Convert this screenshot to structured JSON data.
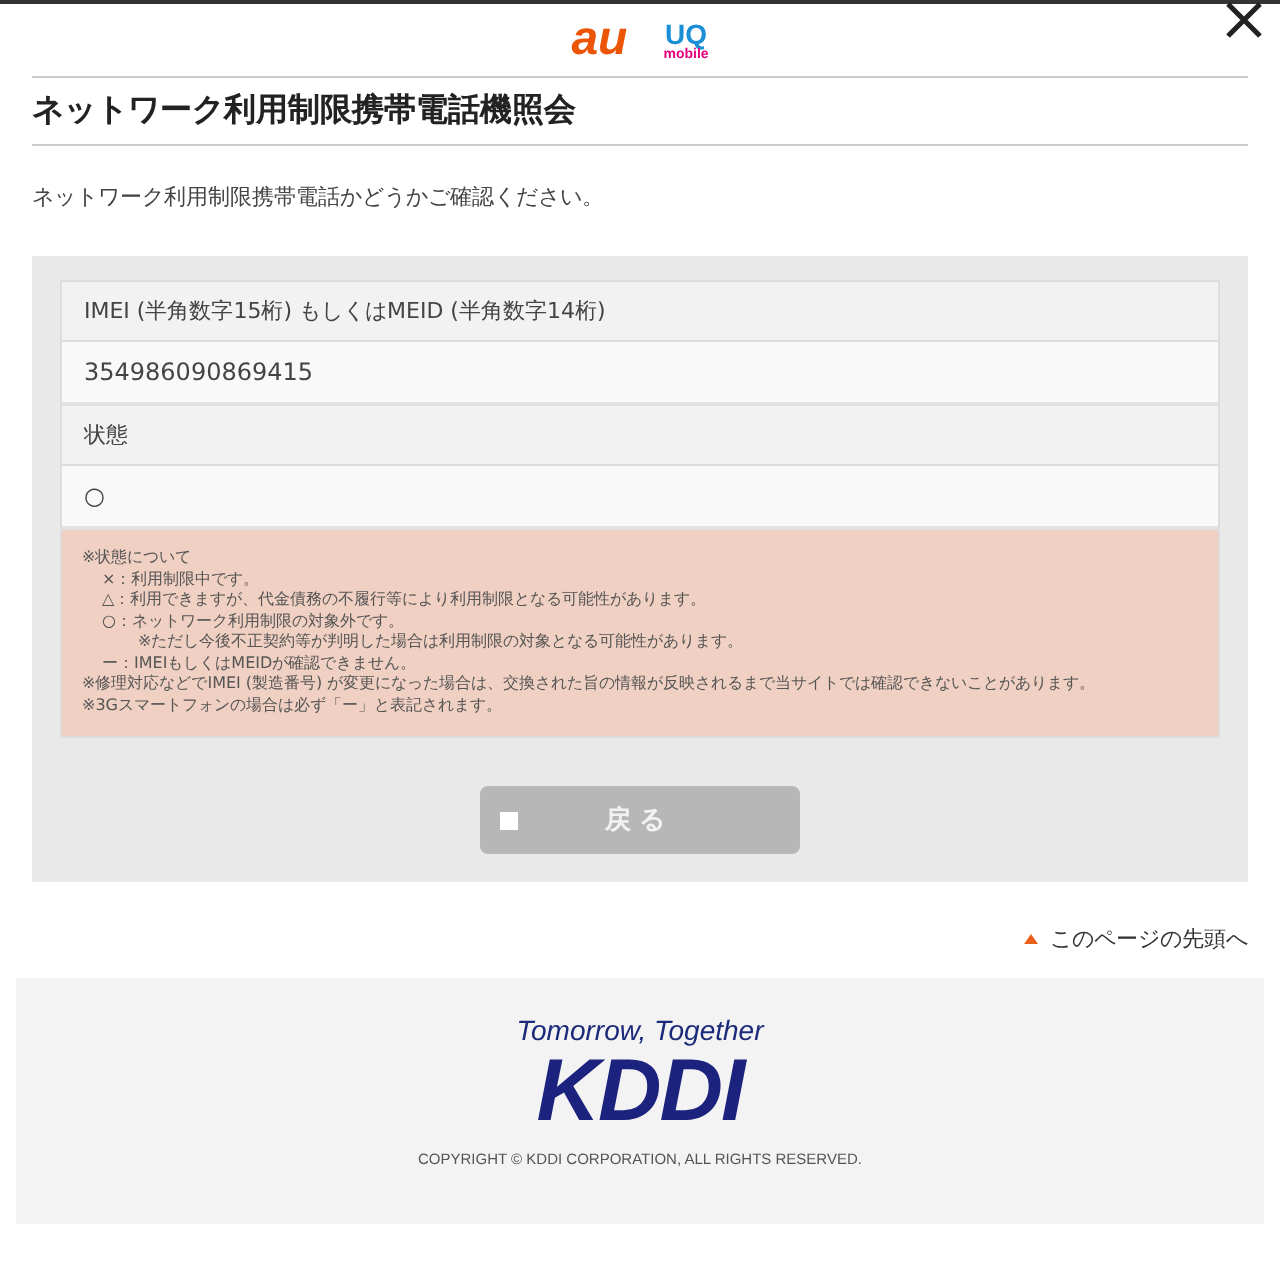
{
  "header": {
    "logo_au": "au",
    "logo_uq": "UQ",
    "logo_uq_sub": "mobile"
  },
  "title": "ネットワーク利用制限携帯電話機照会",
  "intro": "ネットワーク利用制限携帯電話かどうかご確認ください。",
  "fields": [
    {
      "label": "IMEI (半角数字15桁) もしくはMEID (半角数字14桁)",
      "value": "354986090869415"
    },
    {
      "label": "状態",
      "value": "○"
    }
  ],
  "notes": [
    {
      "text": "※状態について",
      "kind": "note"
    },
    {
      "text": "×：利用制限中です。",
      "kind": "item"
    },
    {
      "text": "△：利用できますが、代金債務の不履行等により利用制限となる可能性があります。",
      "kind": "item"
    },
    {
      "text": "○：ネットワーク利用制限の対象外です。",
      "kind": "item"
    },
    {
      "text": "※ただし今後不正契約等が判明した場合は利用制限の対象となる可能性があります。",
      "kind": "subnote"
    },
    {
      "text": "ー：IMEIもしくはMEIDが確認できません。",
      "kind": "item"
    },
    {
      "text": "※修理対応などでIMEI (製造番号) が変更になった場合は、交換された旨の情報が反映されるまで当サイトでは確認できないことがあります。",
      "kind": "note"
    },
    {
      "text": "※3Gスマートフォンの場合は必ず「ー」と表記されます。",
      "kind": "note"
    }
  ],
  "back_button": "戻る",
  "page_top_link": "このページの先頭へ",
  "footer": {
    "tagline": "Tomorrow, Together",
    "logo": "KDDI",
    "copyright": "COPYRIGHT © KDDI CORPORATION, ALL RIGHTS RESERVED."
  }
}
